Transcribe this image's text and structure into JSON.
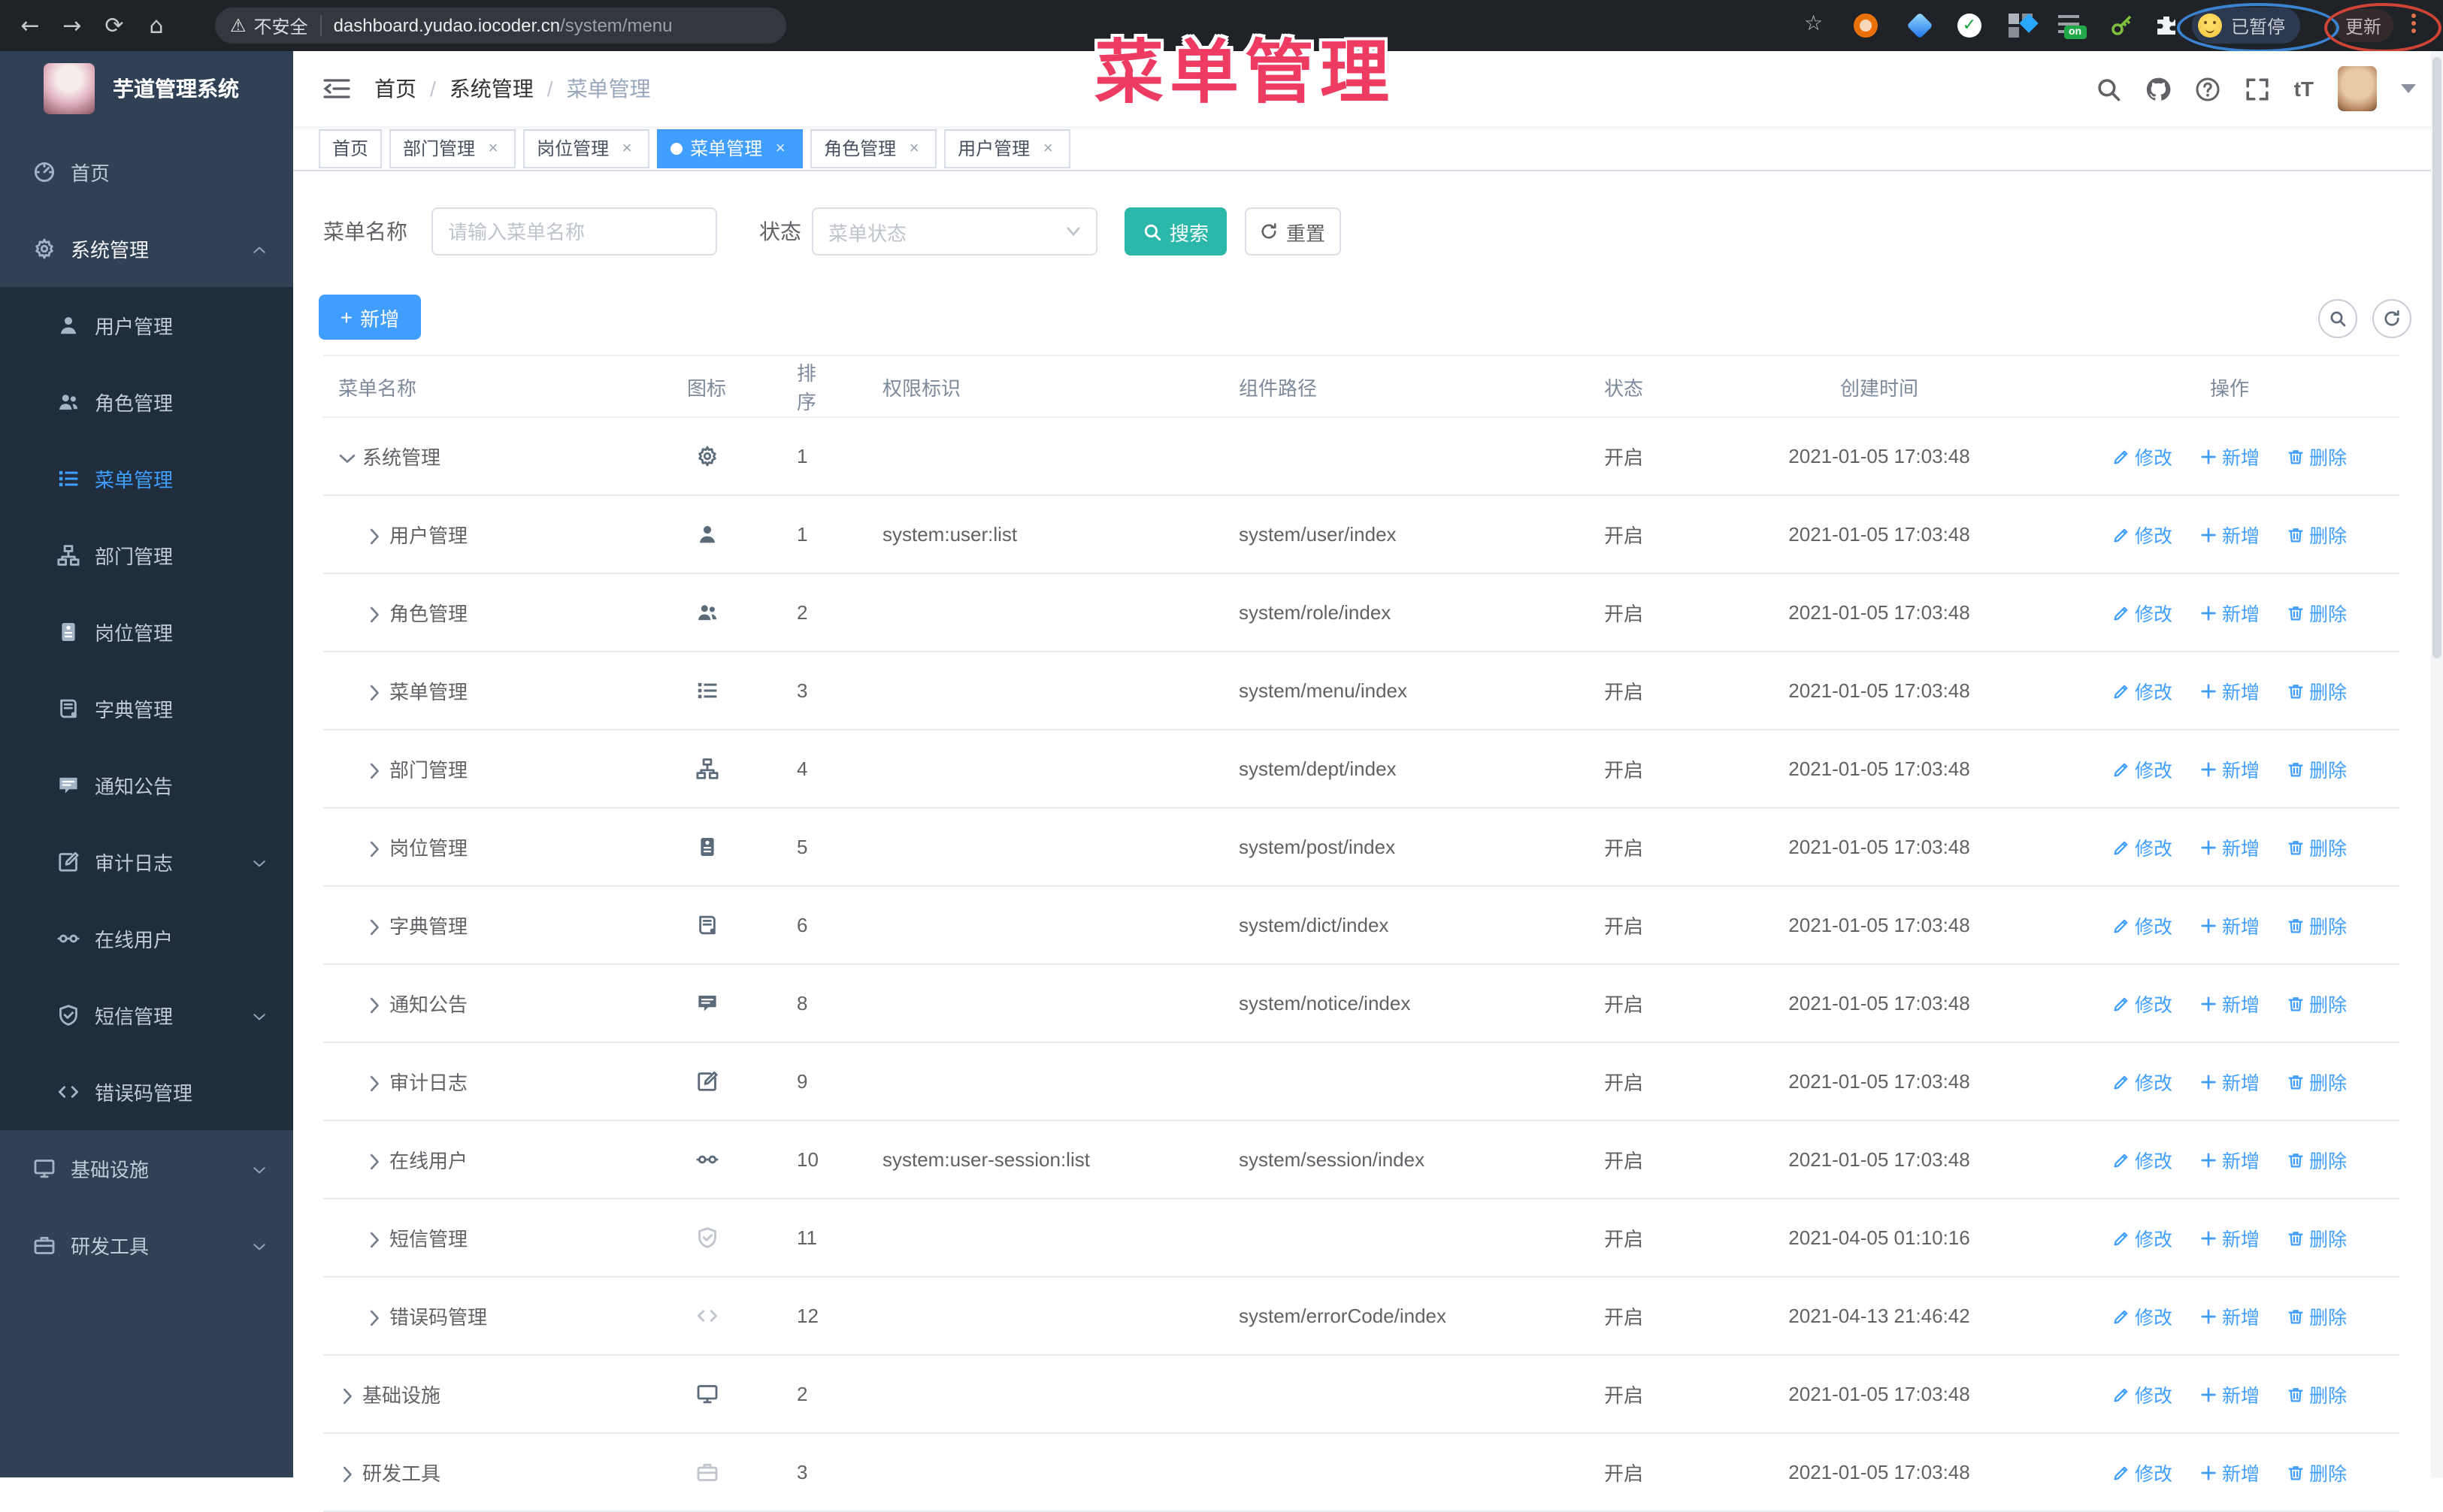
{
  "browser": {
    "security_label": "不安全",
    "url_host": "dashboard.yudao.iocoder.cn",
    "url_path": "/system/menu",
    "paused_badge": "已暂停",
    "update_label": "更新",
    "extension_on_badge": "on"
  },
  "annotation": {
    "title": "菜单管理",
    "color": "#ed3b61"
  },
  "sidebar": {
    "logo_title": "芋道管理系统",
    "items": [
      {
        "label": "首页",
        "icon": "dashboard-icon",
        "level": 0,
        "active": false,
        "chevron": ""
      },
      {
        "label": "系统管理",
        "icon": "gear-icon",
        "level": 0,
        "active": false,
        "open": true,
        "chevron": "up"
      },
      {
        "label": "用户管理",
        "icon": "user-icon",
        "level": 1,
        "active": false,
        "chevron": ""
      },
      {
        "label": "角色管理",
        "icon": "users-icon",
        "level": 1,
        "active": false,
        "chevron": ""
      },
      {
        "label": "菜单管理",
        "icon": "list-icon",
        "level": 1,
        "active": true,
        "chevron": ""
      },
      {
        "label": "部门管理",
        "icon": "tree-icon",
        "level": 1,
        "active": false,
        "chevron": ""
      },
      {
        "label": "岗位管理",
        "icon": "post-icon",
        "level": 1,
        "active": false,
        "chevron": ""
      },
      {
        "label": "字典管理",
        "icon": "dict-icon",
        "level": 1,
        "active": false,
        "chevron": ""
      },
      {
        "label": "通知公告",
        "icon": "message-icon",
        "level": 1,
        "active": false,
        "chevron": ""
      },
      {
        "label": "审计日志",
        "icon": "edit-icon",
        "level": 1,
        "active": false,
        "chevron": "down"
      },
      {
        "label": "在线用户",
        "icon": "online-icon",
        "level": 1,
        "active": false,
        "chevron": ""
      },
      {
        "label": "短信管理",
        "icon": "shield-check-icon",
        "level": 1,
        "active": false,
        "chevron": "down"
      },
      {
        "label": "错误码管理",
        "icon": "code-icon",
        "level": 1,
        "active": false,
        "chevron": ""
      },
      {
        "label": "基础设施",
        "icon": "monitor-icon",
        "level": 0,
        "active": false,
        "chevron": "down"
      },
      {
        "label": "研发工具",
        "icon": "tool-icon",
        "level": 0,
        "active": false,
        "chevron": "down"
      }
    ]
  },
  "header": {
    "breadcrumb": [
      "首页",
      "系统管理",
      "菜单管理"
    ]
  },
  "tabs": [
    {
      "label": "首页",
      "active": false,
      "closable": false
    },
    {
      "label": "部门管理",
      "active": false,
      "closable": true
    },
    {
      "label": "岗位管理",
      "active": false,
      "closable": true
    },
    {
      "label": "菜单管理",
      "active": true,
      "closable": true
    },
    {
      "label": "角色管理",
      "active": false,
      "closable": true
    },
    {
      "label": "用户管理",
      "active": false,
      "closable": true
    }
  ],
  "toolbar": {
    "name_label": "菜单名称",
    "name_placeholder": "请输入菜单名称",
    "status_label": "状态",
    "status_placeholder": "菜单状态",
    "search_label": "搜索",
    "reset_label": "重置",
    "add_label": "新增"
  },
  "table": {
    "columns": [
      "菜单名称",
      "图标",
      "排序",
      "权限标识",
      "组件路径",
      "状态",
      "创建时间",
      "操作"
    ],
    "action_labels": [
      "修改",
      "新增",
      "删除"
    ],
    "rows": [
      {
        "name": "系统管理",
        "icon": "gear-icon",
        "level": 0,
        "caret": "down",
        "sort": "1",
        "perm": "",
        "path": "",
        "status": "开启",
        "time": "2021-01-05 17:03:48",
        "muted_icon": false
      },
      {
        "name": "用户管理",
        "icon": "user-icon",
        "level": 1,
        "caret": "right",
        "sort": "1",
        "perm": "system:user:list",
        "path": "system/user/index",
        "status": "开启",
        "time": "2021-01-05 17:03:48",
        "muted_icon": false
      },
      {
        "name": "角色管理",
        "icon": "users-icon",
        "level": 1,
        "caret": "right",
        "sort": "2",
        "perm": "",
        "path": "system/role/index",
        "status": "开启",
        "time": "2021-01-05 17:03:48",
        "muted_icon": false
      },
      {
        "name": "菜单管理",
        "icon": "list-icon",
        "level": 1,
        "caret": "right",
        "sort": "3",
        "perm": "",
        "path": "system/menu/index",
        "status": "开启",
        "time": "2021-01-05 17:03:48",
        "muted_icon": false
      },
      {
        "name": "部门管理",
        "icon": "tree-icon",
        "level": 1,
        "caret": "right",
        "sort": "4",
        "perm": "",
        "path": "system/dept/index",
        "status": "开启",
        "time": "2021-01-05 17:03:48",
        "muted_icon": false
      },
      {
        "name": "岗位管理",
        "icon": "post-icon",
        "level": 1,
        "caret": "right",
        "sort": "5",
        "perm": "",
        "path": "system/post/index",
        "status": "开启",
        "time": "2021-01-05 17:03:48",
        "muted_icon": false
      },
      {
        "name": "字典管理",
        "icon": "dict-icon",
        "level": 1,
        "caret": "right",
        "sort": "6",
        "perm": "",
        "path": "system/dict/index",
        "status": "开启",
        "time": "2021-01-05 17:03:48",
        "muted_icon": false
      },
      {
        "name": "通知公告",
        "icon": "message-icon",
        "level": 1,
        "caret": "right",
        "sort": "8",
        "perm": "",
        "path": "system/notice/index",
        "status": "开启",
        "time": "2021-01-05 17:03:48",
        "muted_icon": false
      },
      {
        "name": "审计日志",
        "icon": "edit-icon",
        "level": 1,
        "caret": "right",
        "sort": "9",
        "perm": "",
        "path": "",
        "status": "开启",
        "time": "2021-01-05 17:03:48",
        "muted_icon": false
      },
      {
        "name": "在线用户",
        "icon": "online-icon",
        "level": 1,
        "caret": "right",
        "sort": "10",
        "perm": "system:user-session:list",
        "path": "system/session/index",
        "status": "开启",
        "time": "2021-01-05 17:03:48",
        "muted_icon": false
      },
      {
        "name": "短信管理",
        "icon": "shield-check-icon",
        "level": 1,
        "caret": "right",
        "sort": "11",
        "perm": "",
        "path": "",
        "status": "开启",
        "time": "2021-04-05 01:10:16",
        "muted_icon": true
      },
      {
        "name": "错误码管理",
        "icon": "code-icon",
        "level": 1,
        "caret": "right",
        "sort": "12",
        "perm": "",
        "path": "system/errorCode/index",
        "status": "开启",
        "time": "2021-04-13 21:46:42",
        "muted_icon": true
      },
      {
        "name": "基础设施",
        "icon": "monitor-icon",
        "level": 0,
        "caret": "right",
        "sort": "2",
        "perm": "",
        "path": "",
        "status": "开启",
        "time": "2021-01-05 17:03:48",
        "muted_icon": false
      },
      {
        "name": "研发工具",
        "icon": "tool-icon",
        "level": 0,
        "caret": "right",
        "sort": "3",
        "perm": "",
        "path": "",
        "status": "开启",
        "time": "2021-01-05 17:03:48",
        "muted_icon": true
      }
    ]
  }
}
